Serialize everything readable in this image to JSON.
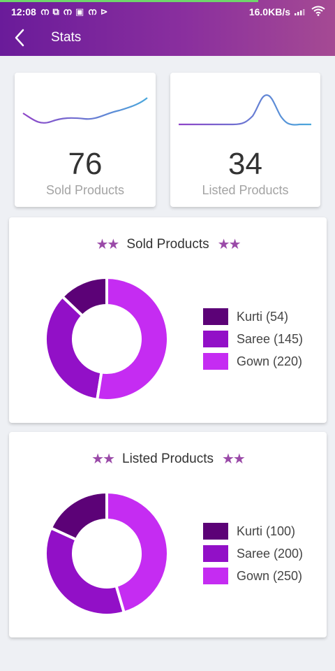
{
  "status": {
    "time": "12:08",
    "notification_icons": "ന ⧉ ന ▣ ന ⊳",
    "net_speed": "16.0KB/s"
  },
  "appbar": {
    "title": "Stats"
  },
  "summary": [
    {
      "value": "76",
      "label": "Sold Products"
    },
    {
      "value": "34",
      "label": "Listed Products"
    }
  ],
  "colors": {
    "kurti": "#5c0277",
    "saree": "#9210c7",
    "gown": "#c52cf2",
    "accent": "#6a1b9a"
  },
  "sold_chart": {
    "title": "Sold Products",
    "stars_left": "★★",
    "stars_right": "★★",
    "legend": [
      "Kurti (54)",
      "Saree (145)",
      "Gown (220)"
    ]
  },
  "listed_chart": {
    "title": "Listed Products",
    "stars_left": "★★",
    "stars_right": "★★",
    "legend": [
      "Kurti (100)",
      "Saree (200)",
      "Gown (250)"
    ]
  },
  "chart_data": [
    {
      "type": "pie",
      "title": "Sold Products",
      "categories": [
        "Kurti",
        "Saree",
        "Gown"
      ],
      "values": [
        54,
        145,
        220
      ],
      "colors": [
        "#5c0277",
        "#9210c7",
        "#c52cf2"
      ]
    },
    {
      "type": "pie",
      "title": "Listed Products",
      "categories": [
        "Kurti",
        "Saree",
        "Gown"
      ],
      "values": [
        100,
        200,
        250
      ],
      "colors": [
        "#5c0277",
        "#9210c7",
        "#c52cf2"
      ]
    }
  ]
}
